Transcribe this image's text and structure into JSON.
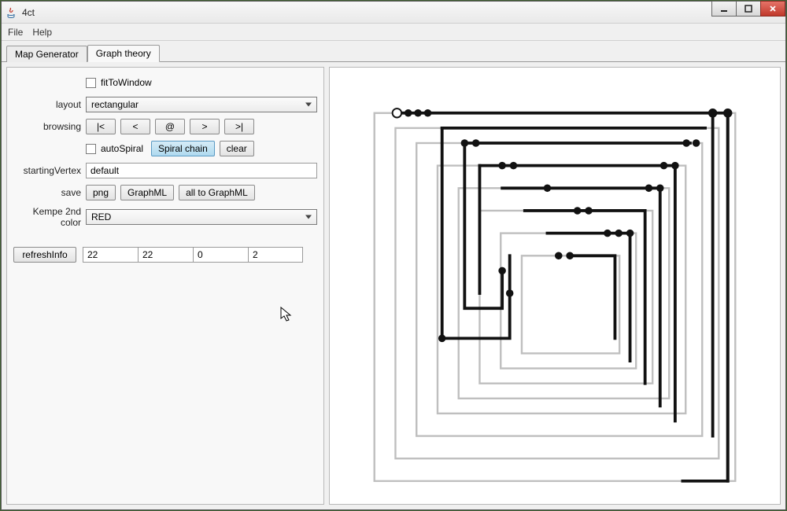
{
  "window": {
    "title": "4ct"
  },
  "menu": {
    "file": "File",
    "help": "Help"
  },
  "tabs": {
    "map_gen": "Map Generator",
    "graph_theory": "Graph theory"
  },
  "controls": {
    "fitToWindow": "fitToWindow",
    "layout_label": "layout",
    "layout_value": "rectangular",
    "browsing_label": "browsing",
    "browsing": {
      "first": "|<",
      "prev": "<",
      "at": "@",
      "next": ">",
      "last": ">|"
    },
    "autoSpiral": "autoSpiral",
    "spiralChain": "Spiral chain",
    "clear": "clear",
    "startingVertex_label": "startingVertex",
    "startingVertex_value": "default",
    "save_label": "save",
    "save": {
      "png": "png",
      "graphml": "GraphML",
      "all": "all to GraphML"
    },
    "kempe_label": "Kempe 2nd color",
    "kempe_value": "RED"
  },
  "info": {
    "refresh": "refreshInfo",
    "v0": "22",
    "v1": "22",
    "v2": "0",
    "v3": "2"
  }
}
